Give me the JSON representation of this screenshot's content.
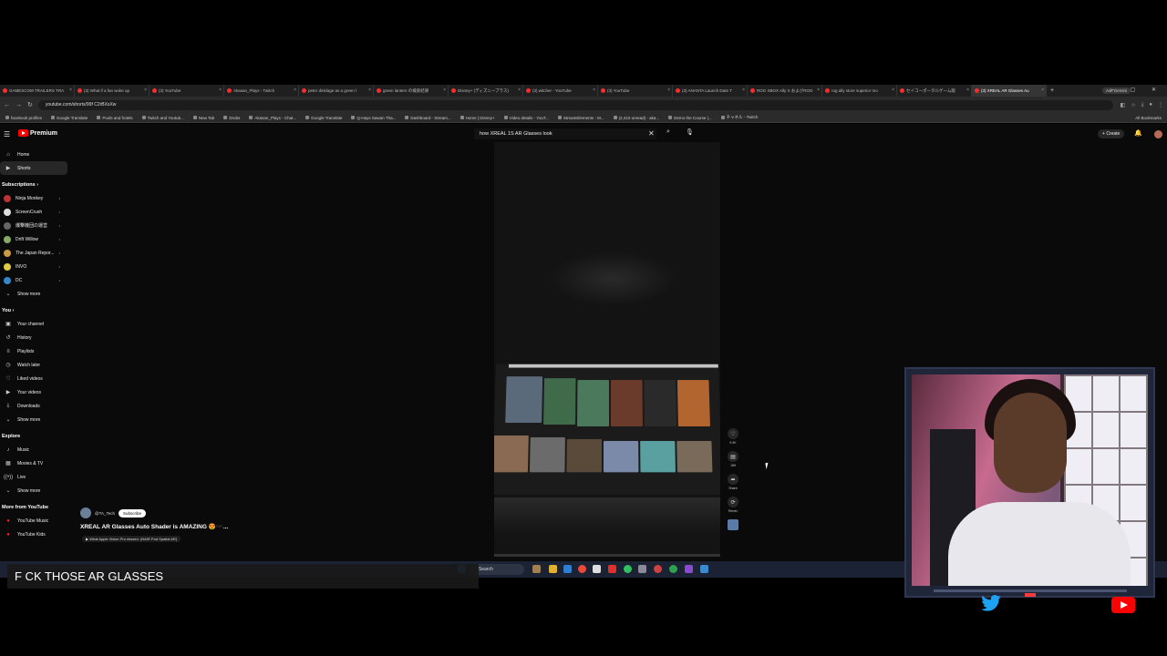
{
  "browser": {
    "tabs": [
      "GAMESCOM TRAILERS TRA",
      "(3) What if a fan woke up",
      "(3) YouTube",
      "Akasan_Plays - Twitch",
      "peter dinklage as a green l",
      "green lantern の検索結果",
      "Disney+ (ディズニープラス)",
      "(3) witcher - YouTube",
      "(3) YouTube",
      "(3) ANANTA Launch Date T",
      "ROG XBOX Ally X およびROG",
      "rog ally store superior mo",
      "セイコーポータルゲーム版",
      "(3) XREAL AR Glasses Au"
    ],
    "profile": "Ask Gemini",
    "url": "youtube.com/shorts/99f C2rBXsXw",
    "bookmarks": [
      "facebook profiles",
      "Google Translate",
      "Pools and hotels",
      "Twitch and Youtub...",
      "New Tab",
      "Drubs",
      "Akasan_Plays - Chat...",
      "Google Translate",
      "Q-Hays Sawan Tha...",
      "Dashboard - Stream...",
      "Home | Disney+",
      "Video details - YouT...",
      "StreamElements - M...",
      "(2,410 unread) - aka...",
      "Demo the Course |...",
      "チャネル - Twitch"
    ],
    "all_bookmarks": "All Bookmarks"
  },
  "youtube": {
    "logo": "Premium",
    "search_value": "how XREAL 1S AR Glasses look",
    "create_label": "Create",
    "sidebar": {
      "home": "Home",
      "shorts": "Shorts",
      "subscriptions_header": "Subscriptions",
      "subscriptions": [
        "Ninja Monkey",
        "ScreenCrush",
        "爆撃機団の運営",
        "Drift Willow",
        "The Japan Repor...",
        "INVO",
        "DC"
      ],
      "show_more_1": "Show more",
      "you_header": "You",
      "you_items": [
        "Your channel",
        "History",
        "Playlists",
        "Watch later",
        "Liked videos",
        "Your videos",
        "Downloads"
      ],
      "show_more_2": "Show more",
      "explore_header": "Explore",
      "explore_items": [
        "Music",
        "Movies & TV",
        "Live"
      ],
      "show_more_3": "Show more",
      "more_header": "More from YouTube",
      "more_items": [
        "YouTube Music",
        "YouTube Kids"
      ]
    },
    "short": {
      "channel": "@TA_Tech",
      "subscribe": "Subscribe",
      "title": "XREAL AR Glasses Auto Shader is AMAZING 😍🕶️...",
      "related": "What Apple Vision Pro missed. (NAIR Pod Spatial AR)",
      "likes": "9.3K",
      "comments": "159",
      "share": "Share",
      "remix": "Remix"
    }
  },
  "taskbar": {
    "search": "Search"
  },
  "overlay": {
    "caption": "F CK THOSE AR GLASSES"
  },
  "colors": {
    "youtube_red": "#ff0000",
    "webcam_frame": "#2f3850",
    "twitter_blue": "#1da1f2"
  }
}
